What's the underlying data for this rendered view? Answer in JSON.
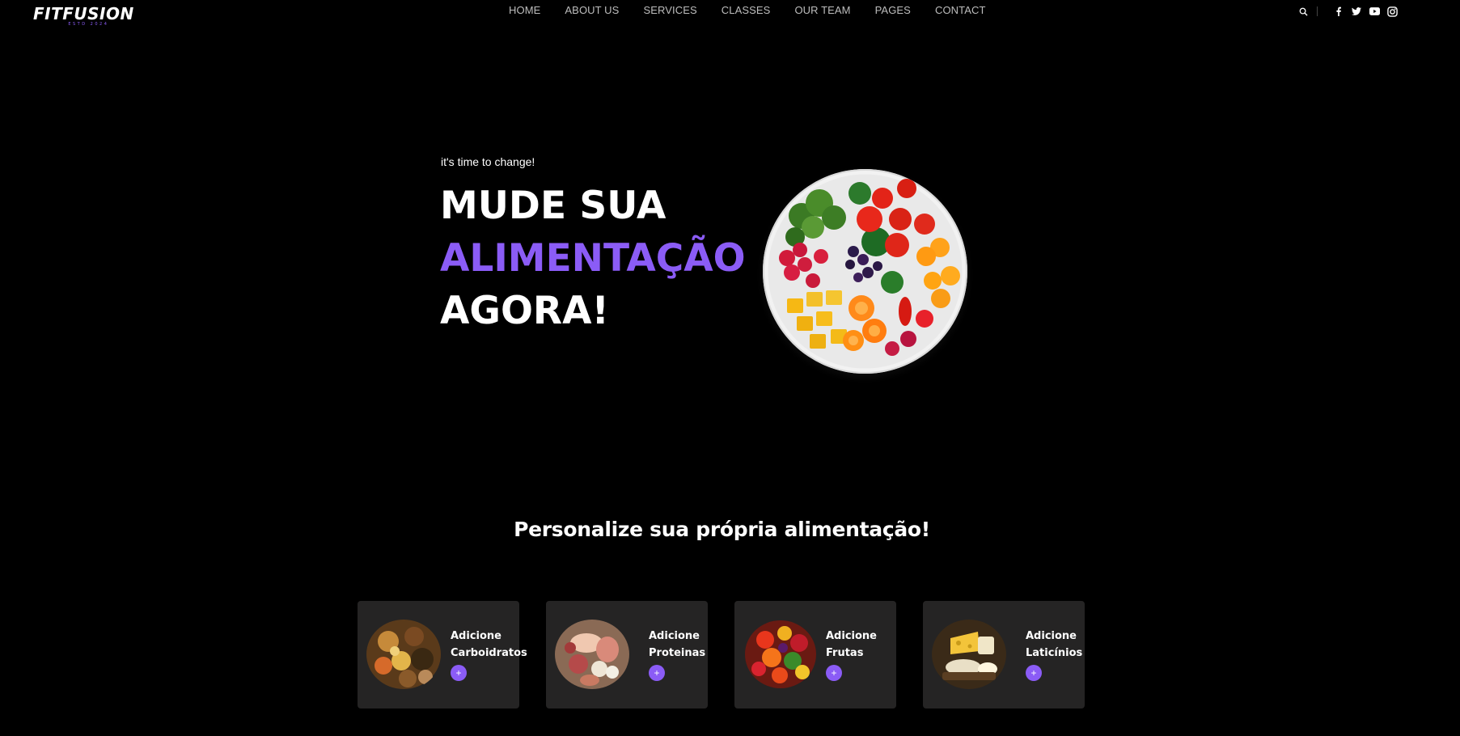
{
  "brand": {
    "name": "FITFUSION",
    "tagline": "ESTD 2024"
  },
  "nav": {
    "items": [
      "HOME",
      "ABOUT US",
      "SERVICES",
      "CLASSES",
      "OUR TEAM",
      "PAGES",
      "CONTACT"
    ]
  },
  "header_icons": [
    "search-icon",
    "facebook-icon",
    "twitter-icon",
    "youtube-icon",
    "instagram-icon"
  ],
  "hero": {
    "kicker": "it's time to change!",
    "line1": "MUDE SUA",
    "line2": "ALIMENTAÇÃO",
    "line3": "AGORA!",
    "image": "fruit-vegetable-plate"
  },
  "section": {
    "title": "Personalize sua própria alimentação!"
  },
  "cards": [
    {
      "line1": "Adicione",
      "line2": "Carboidratos",
      "button": "+",
      "image": "carbohydrates-image"
    },
    {
      "line1": "Adicione",
      "line2": "Proteinas",
      "button": "+",
      "image": "proteins-image"
    },
    {
      "line1": "Adicione",
      "line2": "Frutas",
      "button": "+",
      "image": "fruits-image"
    },
    {
      "line1": "Adicione",
      "line2": "Laticínios",
      "button": "+",
      "image": "dairy-image"
    }
  ],
  "colors": {
    "accent": "#8b5cf6",
    "background": "#000000",
    "card": "#252424",
    "nav_text": "#bdbdbd"
  }
}
